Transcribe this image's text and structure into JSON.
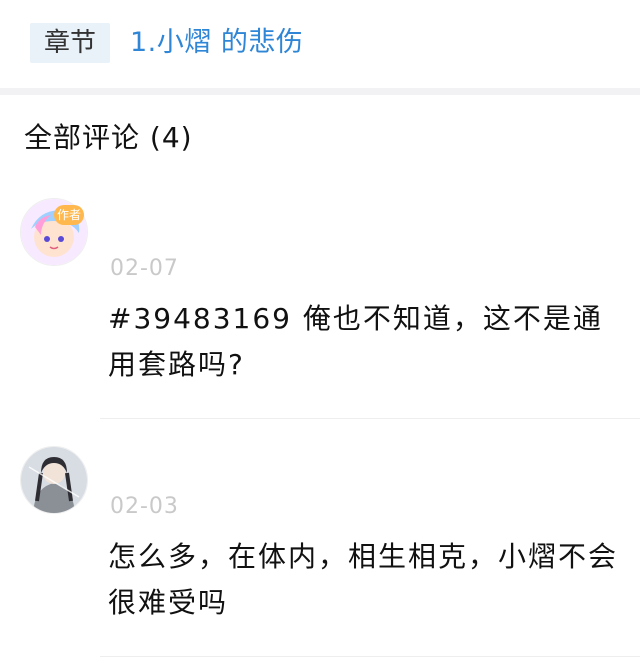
{
  "chapter": {
    "tag_label": "章节",
    "title": "1.小熠 的悲伤"
  },
  "comments_header": "全部评论 (4)",
  "comments": [
    {
      "avatar": "avatar-anime-girl",
      "badge": "作者",
      "date": "02-07",
      "text": "#39483169 俺也不知道，这不是通用套路吗?"
    },
    {
      "avatar": "avatar-anime-swordsman",
      "date": "02-03",
      "text": "怎么多，在体内，相生相克，小熠不会很难受吗"
    }
  ],
  "colors": {
    "accent": "#2f86d6",
    "tag_bg": "#e9f1f9",
    "muted": "#c9c9c9"
  }
}
